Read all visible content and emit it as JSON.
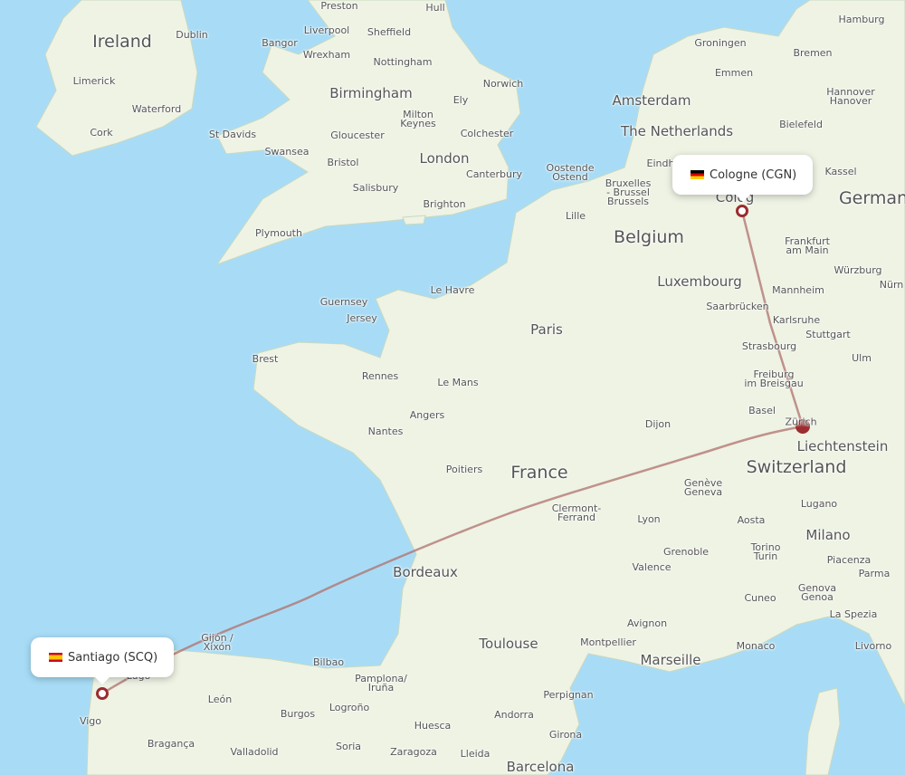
{
  "map": {
    "sea_color": "#a8dcf6",
    "land_color": "#eef3e4",
    "route_color": "#b0706c",
    "marker_color": "#9b2c2f"
  },
  "route": {
    "origin": {
      "label": "Santiago (SCQ)",
      "flag": "spain-flag"
    },
    "destination": {
      "label": "Cologne (CGN)",
      "flag": "germany-flag"
    },
    "stopover": "Zürich"
  },
  "countries": [
    "Ireland",
    "The Netherlands",
    "Belgium",
    "France",
    "Switzerland",
    "German",
    "Liechtenstein",
    "Luxembourg"
  ],
  "cities": [
    "Preston",
    "Hull",
    "Dublin",
    "Liverpool",
    "Sheffield",
    "Hamburg",
    "Groningen",
    "Bangor",
    "Wrexham",
    "Bremen",
    "Nottingham",
    "Emmen",
    "Limerick",
    "Norwich",
    "Birmingham",
    "Amsterdam",
    "Hannover\nHanover",
    "Ely",
    "Waterford",
    "Milton\nKeynes",
    "Bielefeld",
    "Cork",
    "St Davids",
    "Gloucester",
    "Colchester",
    "Swansea",
    "London",
    "Bristol",
    "Eindh",
    "Kassel",
    "Oostende\nOstend",
    "Canterbury",
    "Bruxelles\n- Brussel\nBrussels",
    "Salisbury",
    "Brighton",
    "Lille",
    "Plymouth",
    "Frankfurt\nam Main",
    "Würzburg",
    "Nürn",
    "Mannheim",
    "Saarbrücken",
    "Karlsruhe",
    "Guernsey",
    "Jersey",
    "Le Havre",
    "Paris",
    "Stuttgart",
    "Strasbourg",
    "Brest",
    "Ulm",
    "Freiburg\nim Breisgau",
    "Rennes",
    "Le Mans",
    "Basel",
    "Angers",
    "Dijon",
    "Nantes",
    "Poitiers",
    "Genève\nGeneva",
    "Clermont-\nFerrand",
    "Lugano",
    "Lyon",
    "Aosta",
    "Milano",
    "Torino\nTurin",
    "Grenoble",
    "Piacenza",
    "Valence",
    "Bordeaux",
    "Parma",
    "Cuneo",
    "Genova\nGenoa",
    "Avignon",
    "La Spezia",
    "Toulouse",
    "Montpellier",
    "Monaco",
    "Livorno",
    "Gijón /\nXixón",
    "Bilbao",
    "Marseille",
    "Pamplona/\nIruña",
    "Lugo",
    "Perpignan",
    "León",
    "Andorra",
    "Logroño",
    "Burgos",
    "Vigo",
    "Huesca",
    "Girona",
    "Bragança",
    "Soria",
    "Valladolid",
    "Zaragoza",
    "Lleida",
    "Barcelona",
    "Colog"
  ]
}
